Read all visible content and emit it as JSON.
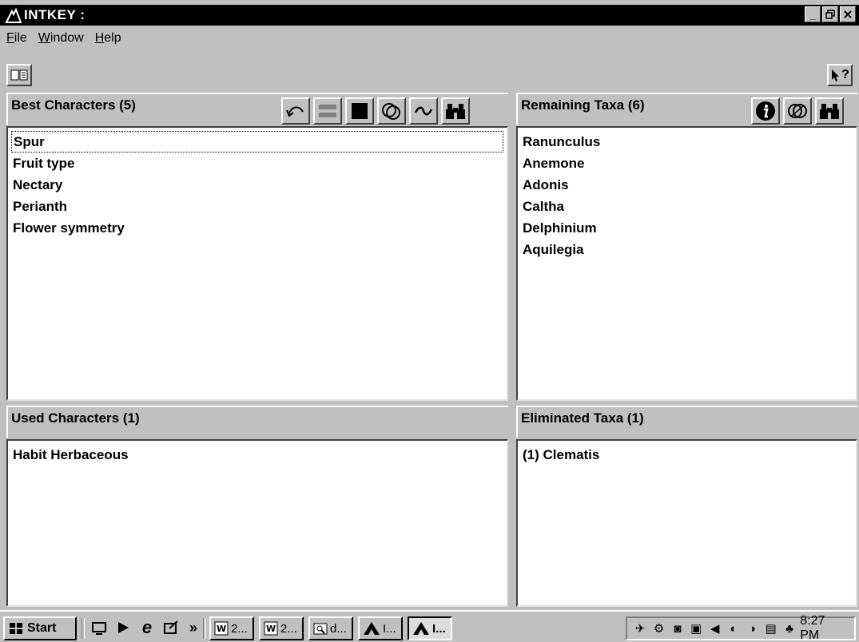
{
  "window": {
    "title": "INTKEY :"
  },
  "menu": [
    {
      "label": "File",
      "key": "F",
      "rest": "ile"
    },
    {
      "label": "Window",
      "key": "W",
      "rest": "indow"
    },
    {
      "label": "Help",
      "key": "H",
      "rest": "elp"
    }
  ],
  "help_button_label": "?",
  "panels": {
    "best_characters": {
      "title": "Best Characters (5)",
      "items": [
        "Spur",
        "Fruit type",
        "Nectary",
        "Perianth",
        "Flower symmetry"
      ]
    },
    "remaining_taxa": {
      "title": "Remaining Taxa (6)",
      "items": [
        "Ranunculus",
        "Anemone",
        "Adonis",
        "Caltha",
        "Delphinium",
        "Aquilegia"
      ]
    },
    "used_characters": {
      "title": "Used Characters (1)",
      "items": [
        "Habit Herbaceous"
      ]
    },
    "eliminated_taxa": {
      "title": "Eliminated Taxa (1)",
      "items": [
        "(1) Clematis"
      ]
    }
  },
  "taskbar": {
    "start_label": "Start",
    "overflow_label": "»",
    "tasks": [
      "2...",
      "2...",
      "d...",
      "I...",
      "I..."
    ],
    "clock": "8:27 PM"
  }
}
